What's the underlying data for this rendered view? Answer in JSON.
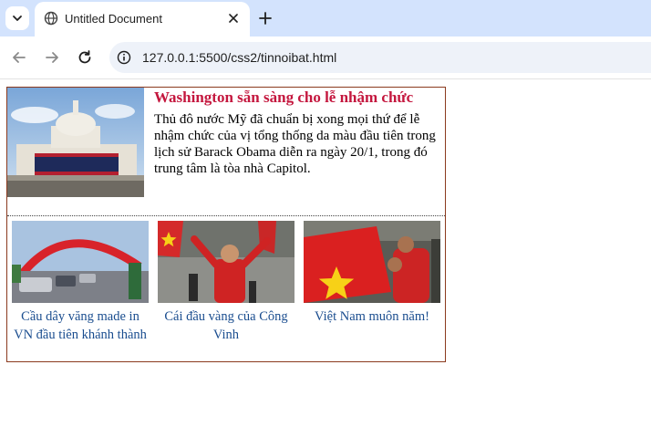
{
  "browser": {
    "tab_title": "Untitled Document",
    "url": "127.0.0.1:5500/css2/tinnoibat.html",
    "accent": "#d3e3fd"
  },
  "article": {
    "title": "Washington sẵn sàng cho lễ nhậm chức",
    "summary": "Thủ đô nước Mỹ đã chuẩn bị xong mọi thứ để lễ nhậm chức của vị tổng thống da màu đầu tiên trong lịch sử Barack Obama diễn ra ngày 20/1, trong đó trung tâm là tòa nhà Capitol.",
    "title_color": "#c4173e",
    "border_color": "#8b3a1e"
  },
  "items": [
    {
      "caption": "Cầu dây văng made in VN đầu tiên khánh thành"
    },
    {
      "caption": "Cái đầu vàng của Công Vinh"
    },
    {
      "caption": "Việt Nam muôn năm!"
    }
  ],
  "link_color": "#1a4d8f"
}
